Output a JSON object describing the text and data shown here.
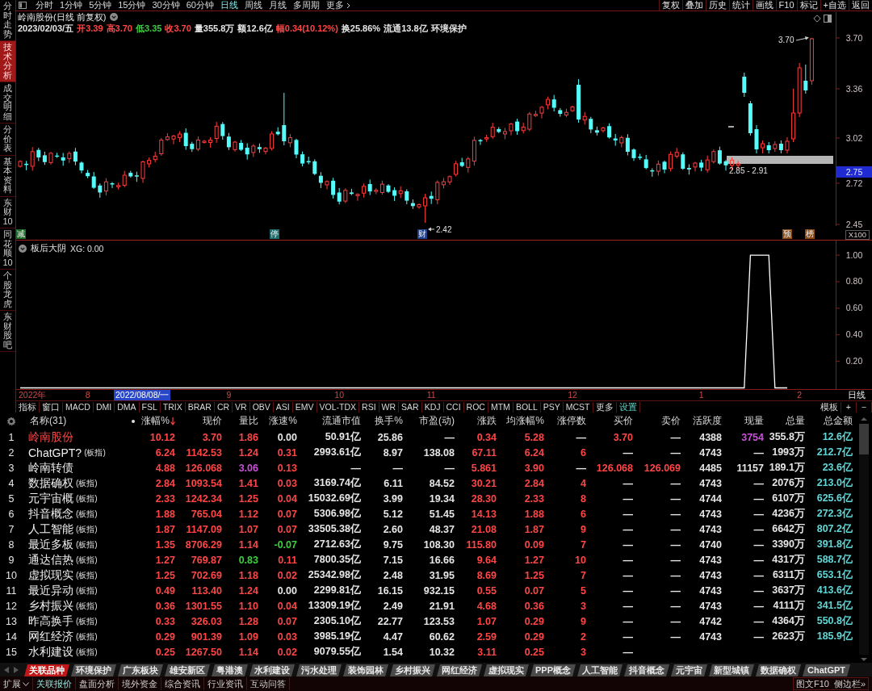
{
  "side_tabs": [
    {
      "label": "分时走势",
      "selected": false
    },
    {
      "label": "技术分析",
      "selected": true
    },
    {
      "label": "成交明细",
      "selected": false
    },
    {
      "label": "分价表",
      "selected": false
    },
    {
      "label": "基本资料",
      "selected": false
    },
    {
      "label": "东财10",
      "selected": false
    },
    {
      "label": "同花顺10",
      "selected": false
    },
    {
      "label": "个股龙虎",
      "selected": false
    },
    {
      "label": "东财股吧",
      "selected": false
    }
  ],
  "toolbar": {
    "periods": [
      {
        "label": "分时",
        "kind": "tab",
        "selected": false
      },
      {
        "label": "1分钟",
        "kind": "tab",
        "selected": false
      },
      {
        "label": "5分钟",
        "kind": "tab",
        "selected": false
      },
      {
        "label": "15分钟",
        "kind": "tab",
        "selected": false
      },
      {
        "label": "30分钟",
        "kind": "tab",
        "selected": false
      },
      {
        "label": "60分钟",
        "kind": "tab",
        "selected": false
      },
      {
        "label": "日线",
        "kind": "tab",
        "selected": true
      },
      {
        "label": "周线",
        "kind": "tab",
        "selected": false
      },
      {
        "label": "月线",
        "kind": "tab",
        "selected": false
      },
      {
        "label": "多周期",
        "kind": "tab",
        "selected": false
      },
      {
        "label": "更多",
        "kind": "menu",
        "selected": false
      }
    ],
    "actions": [
      "复权",
      "叠加",
      "历史",
      "统计",
      "画线",
      "F10",
      "标记",
      "+自选",
      "返回"
    ]
  },
  "price_chart": {
    "title": "岭南股份(日线 前复权)",
    "quote": [
      {
        "text": "2023/02/03/五",
        "color": "#e6e6e6"
      },
      {
        "text": "开3.39",
        "color": "#ff4646"
      },
      {
        "text": "高3.70",
        "color": "#ff4646"
      },
      {
        "text": "低3.35",
        "color": "#3ccf3c"
      },
      {
        "text": "收3.70",
        "color": "#ff4646"
      },
      {
        "text": "量355.8万",
        "color": "#e6e6e6"
      },
      {
        "text": "额12.6亿",
        "color": "#e6e6e6"
      },
      {
        "text": "幅0.34(10.12%)",
        "color": "#ff4646"
      },
      {
        "text": "换25.86%",
        "color": "#e6e6e6"
      },
      {
        "text": "流通13.8亿",
        "color": "#e6e6e6"
      },
      {
        "text": "环境保护",
        "color": "#e6e6e6"
      }
    ],
    "price_axis": [
      "3.70",
      "3.36",
      "3.02",
      "2.72",
      "2.45"
    ],
    "cursor_price": "2.75",
    "scale": "X100",
    "high_label": "3.70",
    "low_label": "2.42",
    "band_label": "2.85 - 2.91",
    "events": [
      {
        "label": "减",
        "color": "#1f6b2a"
      },
      {
        "label": "停",
        "color": "#1f6b6b"
      },
      {
        "label": "财",
        "color": "#1e3f8a"
      },
      {
        "label": "预",
        "color": "#8a4a14"
      },
      {
        "label": "榜",
        "color": "#8a4a14"
      }
    ]
  },
  "indicator": {
    "name": "板后大阴",
    "reading": "XG: 0.00",
    "chart_data": {
      "type": "line",
      "categories": [
        null,
        null,
        "2022年",
        null,
        null,
        null,
        null,
        null,
        null,
        null,
        null,
        "8",
        null,
        null,
        null,
        null,
        null,
        null,
        null,
        null,
        null,
        null,
        null,
        null,
        null,
        null,
        null,
        null,
        null,
        null,
        null,
        null,
        null,
        null,
        "9",
        null,
        null,
        null,
        null,
        null,
        null,
        null,
        null,
        null,
        null,
        null,
        null,
        null,
        null,
        null,
        null,
        null,
        "10",
        null,
        null,
        null,
        null,
        null,
        null,
        null,
        null,
        null,
        null,
        null,
        null,
        null,
        null,
        "11",
        null,
        null,
        null,
        null,
        null,
        null,
        null,
        null,
        null,
        null,
        null,
        null,
        null,
        null,
        null,
        null,
        null,
        null,
        null,
        null,
        null,
        null,
        "12",
        null,
        null,
        null,
        null,
        null,
        null,
        null,
        null,
        null,
        null,
        null,
        null,
        null,
        null,
        null,
        null,
        null,
        null,
        null,
        null,
        "1",
        null,
        null,
        null,
        null,
        null,
        null,
        null,
        null,
        null,
        null,
        null,
        null,
        null,
        null,
        null,
        "2",
        null,
        null
      ],
      "ylim": [
        0,
        1.11
      ],
      "yticks": [
        {
          "value": 1,
          "label": "1.00"
        },
        {
          "value": 0.8,
          "label": "0.80"
        },
        {
          "value": 0.6,
          "label": "0.60"
        },
        {
          "value": 0.4,
          "label": "0.40"
        },
        {
          "value": 0.2,
          "label": "0.20"
        }
      ],
      "series": [
        {
          "color": "#ffffff",
          "values": [
            0,
            0,
            0,
            0,
            0,
            0,
            0,
            0,
            0,
            0,
            0,
            0,
            0,
            0,
            0,
            0,
            0,
            0,
            0,
            0,
            0,
            0,
            0,
            0,
            0,
            0,
            0,
            0,
            0,
            0,
            0,
            0,
            0,
            0,
            0,
            0,
            0,
            0,
            0,
            0,
            0,
            0,
            0,
            0,
            0,
            0,
            0,
            0,
            0,
            0,
            0,
            0,
            0,
            0,
            0,
            0,
            0,
            0,
            0,
            0,
            0,
            0,
            0,
            0,
            0,
            0,
            0,
            0,
            0,
            0,
            0,
            0,
            0,
            0,
            0,
            0,
            0,
            0,
            0,
            0,
            0,
            0,
            0,
            0,
            0,
            0,
            0,
            0,
            0,
            0,
            0,
            0,
            0,
            0,
            0,
            0,
            0,
            0,
            0,
            0,
            0,
            0,
            0,
            0,
            0,
            0,
            0,
            0,
            0,
            0,
            0,
            0,
            0,
            0,
            0,
            0,
            0,
            0,
            0,
            1,
            1,
            1,
            1,
            0,
            0,
            0,
            null,
            null,
            null,
            null
          ]
        }
      ]
    }
  },
  "date_axis": {
    "cursor_date": "2022/08/08/一",
    "period": "日线"
  },
  "indicator_tabs": {
    "items": [
      {
        "label": "指标",
        "selected": false
      },
      {
        "label": "窗口",
        "selected": false
      },
      {
        "label": "MACD",
        "selected": false
      },
      {
        "label": "DMI",
        "selected": false
      },
      {
        "label": "DMA",
        "selected": false
      },
      {
        "label": "FSL",
        "selected": false
      },
      {
        "label": "TRIX",
        "selected": false
      },
      {
        "label": "BRAR",
        "selected": false
      },
      {
        "label": "CR",
        "selected": false
      },
      {
        "label": "VR",
        "selected": false
      },
      {
        "label": "OBV",
        "selected": false
      },
      {
        "label": "ASI",
        "selected": false
      },
      {
        "label": "EMV",
        "selected": false
      },
      {
        "label": "VOL-TDX",
        "selected": false
      },
      {
        "label": "RSI",
        "selected": false
      },
      {
        "label": "WR",
        "selected": false
      },
      {
        "label": "SAR",
        "selected": false
      },
      {
        "label": "KDJ",
        "selected": false
      },
      {
        "label": "CCI",
        "selected": false
      },
      {
        "label": "ROC",
        "selected": false
      },
      {
        "label": "MTM",
        "selected": false
      },
      {
        "label": "BOLL",
        "selected": false
      },
      {
        "label": "PSY",
        "selected": false
      },
      {
        "label": "MCST",
        "selected": false
      },
      {
        "label": "更多",
        "selected": false
      },
      {
        "label": "设置",
        "selected": true
      }
    ],
    "template": "模板",
    "add": "+",
    "remove": "−"
  },
  "table": {
    "name_column": "名称(31)",
    "columns": [
      {
        "label": "涨幅%",
        "sorted": true
      },
      {
        "label": "现价",
        "sorted": false
      },
      {
        "label": "量比",
        "sorted": false
      },
      {
        "label": "涨速%",
        "sorted": false
      },
      {
        "label": "流通市值",
        "sorted": false
      },
      {
        "label": "换手%",
        "sorted": false
      },
      {
        "label": "市盈(动)",
        "sorted": false
      },
      {
        "label": "涨跌",
        "sorted": false
      },
      {
        "label": "均涨幅%",
        "sorted": false
      },
      {
        "label": "涨停数",
        "sorted": false
      },
      {
        "label": "买价",
        "sorted": false
      },
      {
        "label": "卖价",
        "sorted": false
      },
      {
        "label": "活跃度",
        "sorted": false
      },
      {
        "label": "现量",
        "sorted": false
      },
      {
        "label": "总量",
        "sorted": false
      },
      {
        "label": "总金额",
        "sorted": false
      }
    ],
    "rows": [
      {
        "no": "1",
        "name": "岭南股份",
        "current": true,
        "cells": [
          {
            "text": "10.12",
            "color": "#ff4646"
          },
          {
            "text": "3.70",
            "color": "#ff4646"
          },
          {
            "text": "1.86",
            "color": "#ff4646"
          },
          {
            "text": "0.00",
            "color": "#e6e6e6"
          },
          {
            "text": "50.91亿",
            "color": "#e6e6e6"
          },
          {
            "text": "25.86",
            "color": "#e6e6e6"
          },
          {
            "text": "—",
            "color": "#e6e6e6"
          },
          {
            "text": "0.34",
            "color": "#ff4646"
          },
          {
            "text": "5.28",
            "color": "#ff4646"
          },
          {
            "text": "—",
            "color": "#e6e6e6"
          },
          {
            "text": "3.70",
            "color": "#ff4646"
          },
          {
            "text": "—",
            "color": "#e6e6e6"
          },
          {
            "text": "4388",
            "color": "#e6e6e6"
          },
          {
            "text": "3754",
            "color": "#cc4fdc"
          },
          {
            "text": "355.8万",
            "color": "#e6e6e6"
          },
          {
            "text": "12.6亿",
            "color": "#62d6d6"
          }
        ]
      },
      {
        "no": "2",
        "name": "ChatGPT?",
        "tag": "(板指)",
        "current": false,
        "cells": [
          {
            "text": "6.24",
            "color": "#ff4646"
          },
          {
            "text": "1142.53",
            "color": "#ff4646"
          },
          {
            "text": "1.24",
            "color": "#ff4646"
          },
          {
            "text": "0.31",
            "color": "#ff4646"
          },
          {
            "text": "2993.61亿",
            "color": "#e6e6e6"
          },
          {
            "text": "8.97",
            "color": "#e6e6e6"
          },
          {
            "text": "138.08",
            "color": "#e6e6e6"
          },
          {
            "text": "67.11",
            "color": "#ff4646"
          },
          {
            "text": "6.24",
            "color": "#ff4646"
          },
          {
            "text": "6",
            "color": "#ff4646"
          },
          {
            "text": "—",
            "color": "#e6e6e6"
          },
          {
            "text": "—",
            "color": "#e6e6e6"
          },
          {
            "text": "4743",
            "color": "#e6e6e6"
          },
          {
            "text": "—",
            "color": "#e6e6e6"
          },
          {
            "text": "1993万",
            "color": "#e6e6e6"
          },
          {
            "text": "212.7亿",
            "color": "#62d6d6"
          }
        ]
      },
      {
        "no": "3",
        "name": "岭南转债",
        "current": false,
        "cells": [
          {
            "text": "4.88",
            "color": "#ff4646"
          },
          {
            "text": "126.068",
            "color": "#ff4646"
          },
          {
            "text": "3.06",
            "color": "#cc4fdc"
          },
          {
            "text": "0.13",
            "color": "#ff4646"
          },
          {
            "text": "—",
            "color": "#e6e6e6"
          },
          {
            "text": "—",
            "color": "#e6e6e6"
          },
          {
            "text": "—",
            "color": "#e6e6e6"
          },
          {
            "text": "5.861",
            "color": "#ff4646"
          },
          {
            "text": "3.90",
            "color": "#ff4646"
          },
          {
            "text": "—",
            "color": "#e6e6e6"
          },
          {
            "text": "126.068",
            "color": "#ff4646"
          },
          {
            "text": "126.069",
            "color": "#ff4646"
          },
          {
            "text": "4485",
            "color": "#e6e6e6"
          },
          {
            "text": "11157",
            "color": "#e6e6e6"
          },
          {
            "text": "189.1万",
            "color": "#e6e6e6"
          },
          {
            "text": "23.6亿",
            "color": "#62d6d6"
          }
        ]
      },
      {
        "no": "4",
        "name": "数据确权",
        "tag": "(板指)",
        "current": false,
        "cells": [
          {
            "text": "2.84",
            "color": "#ff4646"
          },
          {
            "text": "1093.54",
            "color": "#ff4646"
          },
          {
            "text": "1.41",
            "color": "#ff4646"
          },
          {
            "text": "0.03",
            "color": "#ff4646"
          },
          {
            "text": "3169.74亿",
            "color": "#e6e6e6"
          },
          {
            "text": "6.11",
            "color": "#e6e6e6"
          },
          {
            "text": "84.52",
            "color": "#e6e6e6"
          },
          {
            "text": "30.21",
            "color": "#ff4646"
          },
          {
            "text": "2.84",
            "color": "#ff4646"
          },
          {
            "text": "4",
            "color": "#ff4646"
          },
          {
            "text": "—",
            "color": "#e6e6e6"
          },
          {
            "text": "—",
            "color": "#e6e6e6"
          },
          {
            "text": "4743",
            "color": "#e6e6e6"
          },
          {
            "text": "—",
            "color": "#e6e6e6"
          },
          {
            "text": "2076万",
            "color": "#e6e6e6"
          },
          {
            "text": "213.0亿",
            "color": "#62d6d6"
          }
        ]
      },
      {
        "no": "5",
        "name": "元宇宙概",
        "tag": "(板指)",
        "current": false,
        "cells": [
          {
            "text": "2.33",
            "color": "#ff4646"
          },
          {
            "text": "1242.34",
            "color": "#ff4646"
          },
          {
            "text": "1.25",
            "color": "#ff4646"
          },
          {
            "text": "0.04",
            "color": "#ff4646"
          },
          {
            "text": "15032.69亿",
            "color": "#e6e6e6"
          },
          {
            "text": "3.99",
            "color": "#e6e6e6"
          },
          {
            "text": "19.34",
            "color": "#e6e6e6"
          },
          {
            "text": "28.30",
            "color": "#ff4646"
          },
          {
            "text": "2.33",
            "color": "#ff4646"
          },
          {
            "text": "8",
            "color": "#ff4646"
          },
          {
            "text": "—",
            "color": "#e6e6e6"
          },
          {
            "text": "—",
            "color": "#e6e6e6"
          },
          {
            "text": "4744",
            "color": "#e6e6e6"
          },
          {
            "text": "—",
            "color": "#e6e6e6"
          },
          {
            "text": "6107万",
            "color": "#e6e6e6"
          },
          {
            "text": "625.6亿",
            "color": "#62d6d6"
          }
        ]
      },
      {
        "no": "6",
        "name": "抖音概念",
        "tag": "(板指)",
        "current": false,
        "cells": [
          {
            "text": "1.88",
            "color": "#ff4646"
          },
          {
            "text": "765.04",
            "color": "#ff4646"
          },
          {
            "text": "1.12",
            "color": "#ff4646"
          },
          {
            "text": "0.07",
            "color": "#ff4646"
          },
          {
            "text": "5306.98亿",
            "color": "#e6e6e6"
          },
          {
            "text": "5.12",
            "color": "#e6e6e6"
          },
          {
            "text": "51.45",
            "color": "#e6e6e6"
          },
          {
            "text": "14.13",
            "color": "#ff4646"
          },
          {
            "text": "1.88",
            "color": "#ff4646"
          },
          {
            "text": "6",
            "color": "#ff4646"
          },
          {
            "text": "—",
            "color": "#e6e6e6"
          },
          {
            "text": "—",
            "color": "#e6e6e6"
          },
          {
            "text": "4743",
            "color": "#e6e6e6"
          },
          {
            "text": "—",
            "color": "#e6e6e6"
          },
          {
            "text": "4236万",
            "color": "#e6e6e6"
          },
          {
            "text": "272.3亿",
            "color": "#62d6d6"
          }
        ]
      },
      {
        "no": "7",
        "name": "人工智能",
        "tag": "(板指)",
        "current": false,
        "cells": [
          {
            "text": "1.87",
            "color": "#ff4646"
          },
          {
            "text": "1147.09",
            "color": "#ff4646"
          },
          {
            "text": "1.07",
            "color": "#ff4646"
          },
          {
            "text": "0.07",
            "color": "#ff4646"
          },
          {
            "text": "33505.38亿",
            "color": "#e6e6e6"
          },
          {
            "text": "2.60",
            "color": "#e6e6e6"
          },
          {
            "text": "48.37",
            "color": "#e6e6e6"
          },
          {
            "text": "21.08",
            "color": "#ff4646"
          },
          {
            "text": "1.87",
            "color": "#ff4646"
          },
          {
            "text": "9",
            "color": "#ff4646"
          },
          {
            "text": "—",
            "color": "#e6e6e6"
          },
          {
            "text": "—",
            "color": "#e6e6e6"
          },
          {
            "text": "4743",
            "color": "#e6e6e6"
          },
          {
            "text": "—",
            "color": "#e6e6e6"
          },
          {
            "text": "6642万",
            "color": "#e6e6e6"
          },
          {
            "text": "807.2亿",
            "color": "#62d6d6"
          }
        ]
      },
      {
        "no": "8",
        "name": "最近多板",
        "tag": "(板指)",
        "current": false,
        "cells": [
          {
            "text": "1.35",
            "color": "#ff4646"
          },
          {
            "text": "8706.29",
            "color": "#ff4646"
          },
          {
            "text": "1.14",
            "color": "#ff4646"
          },
          {
            "text": "-0.07",
            "color": "#3ccf3c"
          },
          {
            "text": "2712.63亿",
            "color": "#e6e6e6"
          },
          {
            "text": "9.75",
            "color": "#e6e6e6"
          },
          {
            "text": "108.30",
            "color": "#e6e6e6"
          },
          {
            "text": "115.80",
            "color": "#ff4646"
          },
          {
            "text": "0.09",
            "color": "#ff4646"
          },
          {
            "text": "7",
            "color": "#ff4646"
          },
          {
            "text": "—",
            "color": "#e6e6e6"
          },
          {
            "text": "—",
            "color": "#e6e6e6"
          },
          {
            "text": "4740",
            "color": "#e6e6e6"
          },
          {
            "text": "—",
            "color": "#e6e6e6"
          },
          {
            "text": "3390万",
            "color": "#e6e6e6"
          },
          {
            "text": "391.8亿",
            "color": "#62d6d6"
          }
        ]
      },
      {
        "no": "9",
        "name": "通达信热",
        "tag": "(板指)",
        "current": false,
        "cells": [
          {
            "text": "1.27",
            "color": "#ff4646"
          },
          {
            "text": "769.87",
            "color": "#ff4646"
          },
          {
            "text": "0.83",
            "color": "#3ccf3c"
          },
          {
            "text": "0.11",
            "color": "#ff4646"
          },
          {
            "text": "7800.35亿",
            "color": "#e6e6e6"
          },
          {
            "text": "7.15",
            "color": "#e6e6e6"
          },
          {
            "text": "16.66",
            "color": "#e6e6e6"
          },
          {
            "text": "9.64",
            "color": "#ff4646"
          },
          {
            "text": "1.27",
            "color": "#ff4646"
          },
          {
            "text": "10",
            "color": "#ff4646"
          },
          {
            "text": "—",
            "color": "#e6e6e6"
          },
          {
            "text": "—",
            "color": "#e6e6e6"
          },
          {
            "text": "4743",
            "color": "#e6e6e6"
          },
          {
            "text": "—",
            "color": "#e6e6e6"
          },
          {
            "text": "4317万",
            "color": "#e6e6e6"
          },
          {
            "text": "588.7亿",
            "color": "#62d6d6"
          }
        ]
      },
      {
        "no": "10",
        "name": "虚拟现实",
        "tag": "(板指)",
        "current": false,
        "cells": [
          {
            "text": "1.25",
            "color": "#ff4646"
          },
          {
            "text": "702.69",
            "color": "#ff4646"
          },
          {
            "text": "1.18",
            "color": "#ff4646"
          },
          {
            "text": "0.02",
            "color": "#ff4646"
          },
          {
            "text": "25342.98亿",
            "color": "#e6e6e6"
          },
          {
            "text": "2.48",
            "color": "#e6e6e6"
          },
          {
            "text": "31.95",
            "color": "#e6e6e6"
          },
          {
            "text": "8.69",
            "color": "#ff4646"
          },
          {
            "text": "1.25",
            "color": "#ff4646"
          },
          {
            "text": "7",
            "color": "#ff4646"
          },
          {
            "text": "—",
            "color": "#e6e6e6"
          },
          {
            "text": "—",
            "color": "#e6e6e6"
          },
          {
            "text": "4743",
            "color": "#e6e6e6"
          },
          {
            "text": "—",
            "color": "#e6e6e6"
          },
          {
            "text": "6311万",
            "color": "#e6e6e6"
          },
          {
            "text": "653.1亿",
            "color": "#62d6d6"
          }
        ]
      },
      {
        "no": "11",
        "name": "最近异动",
        "tag": "(板指)",
        "current": false,
        "cells": [
          {
            "text": "0.49",
            "color": "#ff4646"
          },
          {
            "text": "113.40",
            "color": "#ff4646"
          },
          {
            "text": "1.24",
            "color": "#ff4646"
          },
          {
            "text": "0.00",
            "color": "#e6e6e6"
          },
          {
            "text": "2299.81亿",
            "color": "#e6e6e6"
          },
          {
            "text": "16.15",
            "color": "#e6e6e6"
          },
          {
            "text": "932.15",
            "color": "#e6e6e6"
          },
          {
            "text": "0.55",
            "color": "#ff4646"
          },
          {
            "text": "0.07",
            "color": "#ff4646"
          },
          {
            "text": "5",
            "color": "#ff4646"
          },
          {
            "text": "—",
            "color": "#e6e6e6"
          },
          {
            "text": "—",
            "color": "#e6e6e6"
          },
          {
            "text": "4743",
            "color": "#e6e6e6"
          },
          {
            "text": "—",
            "color": "#e6e6e6"
          },
          {
            "text": "3637万",
            "color": "#e6e6e6"
          },
          {
            "text": "413.6亿",
            "color": "#62d6d6"
          }
        ]
      },
      {
        "no": "12",
        "name": "乡村振兴",
        "tag": "(板指)",
        "current": false,
        "cells": [
          {
            "text": "0.36",
            "color": "#ff4646"
          },
          {
            "text": "1301.55",
            "color": "#ff4646"
          },
          {
            "text": "1.10",
            "color": "#ff4646"
          },
          {
            "text": "0.04",
            "color": "#ff4646"
          },
          {
            "text": "13309.19亿",
            "color": "#e6e6e6"
          },
          {
            "text": "2.49",
            "color": "#e6e6e6"
          },
          {
            "text": "21.91",
            "color": "#e6e6e6"
          },
          {
            "text": "4.68",
            "color": "#ff4646"
          },
          {
            "text": "0.36",
            "color": "#ff4646"
          },
          {
            "text": "3",
            "color": "#ff4646"
          },
          {
            "text": "—",
            "color": "#e6e6e6"
          },
          {
            "text": "—",
            "color": "#e6e6e6"
          },
          {
            "text": "4743",
            "color": "#e6e6e6"
          },
          {
            "text": "—",
            "color": "#e6e6e6"
          },
          {
            "text": "4111万",
            "color": "#e6e6e6"
          },
          {
            "text": "341.5亿",
            "color": "#62d6d6"
          }
        ]
      },
      {
        "no": "13",
        "name": "昨高换手",
        "tag": "(板指)",
        "current": false,
        "cells": [
          {
            "text": "0.33",
            "color": "#ff4646"
          },
          {
            "text": "326.03",
            "color": "#ff4646"
          },
          {
            "text": "1.28",
            "color": "#ff4646"
          },
          {
            "text": "0.07",
            "color": "#ff4646"
          },
          {
            "text": "2305.10亿",
            "color": "#e6e6e6"
          },
          {
            "text": "22.77",
            "color": "#e6e6e6"
          },
          {
            "text": "123.53",
            "color": "#e6e6e6"
          },
          {
            "text": "1.07",
            "color": "#ff4646"
          },
          {
            "text": "0.29",
            "color": "#ff4646"
          },
          {
            "text": "9",
            "color": "#ff4646"
          },
          {
            "text": "—",
            "color": "#e6e6e6"
          },
          {
            "text": "—",
            "color": "#e6e6e6"
          },
          {
            "text": "4742",
            "color": "#e6e6e6"
          },
          {
            "text": "—",
            "color": "#e6e6e6"
          },
          {
            "text": "4364万",
            "color": "#e6e6e6"
          },
          {
            "text": "550.8亿",
            "color": "#62d6d6"
          }
        ]
      },
      {
        "no": "14",
        "name": "网红经济",
        "tag": "(板指)",
        "current": false,
        "cells": [
          {
            "text": "0.29",
            "color": "#ff4646"
          },
          {
            "text": "901.39",
            "color": "#ff4646"
          },
          {
            "text": "1.09",
            "color": "#ff4646"
          },
          {
            "text": "0.03",
            "color": "#ff4646"
          },
          {
            "text": "3985.19亿",
            "color": "#e6e6e6"
          },
          {
            "text": "4.47",
            "color": "#e6e6e6"
          },
          {
            "text": "60.62",
            "color": "#e6e6e6"
          },
          {
            "text": "2.59",
            "color": "#ff4646"
          },
          {
            "text": "0.29",
            "color": "#ff4646"
          },
          {
            "text": "2",
            "color": "#ff4646"
          },
          {
            "text": "—",
            "color": "#e6e6e6"
          },
          {
            "text": "—",
            "color": "#e6e6e6"
          },
          {
            "text": "4743",
            "color": "#e6e6e6"
          },
          {
            "text": "—",
            "color": "#e6e6e6"
          },
          {
            "text": "2623万",
            "color": "#e6e6e6"
          },
          {
            "text": "185.9亿",
            "color": "#62d6d6"
          }
        ]
      },
      {
        "no": "15",
        "name": "水利建设",
        "tag": "(板指)",
        "current": false,
        "cells": [
          {
            "text": "0.25",
            "color": "#ff4646"
          },
          {
            "text": "1267.50",
            "color": "#ff4646"
          },
          {
            "text": "1.14",
            "color": "#ff4646"
          },
          {
            "text": "0.02",
            "color": "#ff4646"
          },
          {
            "text": "9079.55亿",
            "color": "#e6e6e6"
          },
          {
            "text": "1.54",
            "color": "#e6e6e6"
          },
          {
            "text": "10.32",
            "color": "#e6e6e6"
          },
          {
            "text": "3.11",
            "color": "#ff4646"
          },
          {
            "text": "0.25",
            "color": "#ff4646"
          },
          {
            "text": "3",
            "color": "#ff4646"
          },
          {
            "text": "—",
            "color": "#e6e6e6"
          }
        ]
      }
    ]
  },
  "sector_tabs": [
    {
      "label": "关联品种",
      "selected": true
    },
    {
      "label": "环境保护",
      "selected": false
    },
    {
      "label": "广东板块",
      "selected": false
    },
    {
      "label": "雄安新区",
      "selected": false
    },
    {
      "label": "粤港澳",
      "selected": false
    },
    {
      "label": "水利建设",
      "selected": false
    },
    {
      "label": "污水处理",
      "selected": false
    },
    {
      "label": "装饰园林",
      "selected": false
    },
    {
      "label": "乡村振兴",
      "selected": false
    },
    {
      "label": "网红经济",
      "selected": false
    },
    {
      "label": "虚拟现实",
      "selected": false
    },
    {
      "label": "PPP概念",
      "selected": false
    },
    {
      "label": "人工智能",
      "selected": false
    },
    {
      "label": "抖音概念",
      "selected": false
    },
    {
      "label": "元宇宙",
      "selected": false
    },
    {
      "label": "新型城镇",
      "selected": false
    },
    {
      "label": "数据确权",
      "selected": false
    },
    {
      "label": "ChatGPT",
      "selected": false
    }
  ],
  "status_bar": {
    "expand": "扩展",
    "items": [
      {
        "label": "关联报价",
        "selected": true
      },
      {
        "label": "盘面分析",
        "selected": false
      },
      {
        "label": "境外资金",
        "selected": false
      },
      {
        "label": "综合资讯",
        "selected": false
      },
      {
        "label": "行业资讯",
        "selected": false
      },
      {
        "label": "互动问答",
        "selected": false
      }
    ],
    "f10": "图文F10",
    "sidebar": "侧边栏»"
  }
}
